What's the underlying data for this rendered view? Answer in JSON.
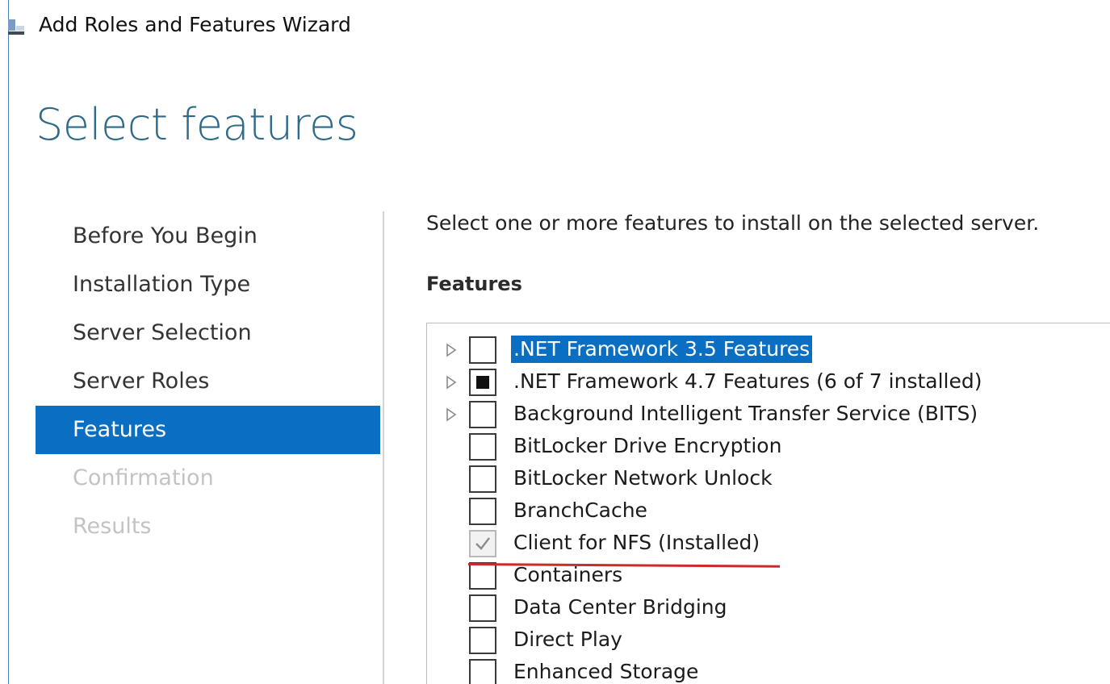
{
  "window": {
    "title": "Add Roles and Features Wizard",
    "icon": "server-manager-icon"
  },
  "page_title": "Select features",
  "nav": {
    "items": [
      {
        "label": "Before You Begin",
        "state": "normal"
      },
      {
        "label": "Installation Type",
        "state": "normal"
      },
      {
        "label": "Server Selection",
        "state": "normal"
      },
      {
        "label": "Server Roles",
        "state": "normal"
      },
      {
        "label": "Features",
        "state": "active"
      },
      {
        "label": "Confirmation",
        "state": "disabled"
      },
      {
        "label": "Results",
        "state": "disabled"
      }
    ]
  },
  "content": {
    "instruction": "Select one or more features to install on the selected server.",
    "features_heading": "Features"
  },
  "features": [
    {
      "label": ".NET Framework 3.5 Features",
      "expandable": true,
      "check": "unchecked",
      "selected": true
    },
    {
      "label": ".NET Framework 4.7 Features (6 of 7 installed)",
      "expandable": true,
      "check": "partial",
      "selected": false
    },
    {
      "label": "Background Intelligent Transfer Service (BITS)",
      "expandable": true,
      "check": "unchecked",
      "selected": false
    },
    {
      "label": "BitLocker Drive Encryption",
      "expandable": false,
      "check": "unchecked",
      "selected": false
    },
    {
      "label": "BitLocker Network Unlock",
      "expandable": false,
      "check": "unchecked",
      "selected": false
    },
    {
      "label": "BranchCache",
      "expandable": false,
      "check": "unchecked",
      "selected": false
    },
    {
      "label": "Client for NFS (Installed)",
      "expandable": false,
      "check": "installed",
      "selected": false,
      "annotated": true
    },
    {
      "label": "Containers",
      "expandable": false,
      "check": "unchecked",
      "selected": false
    },
    {
      "label": "Data Center Bridging",
      "expandable": false,
      "check": "unchecked",
      "selected": false
    },
    {
      "label": "Direct Play",
      "expandable": false,
      "check": "unchecked",
      "selected": false
    },
    {
      "label": "Enhanced Storage",
      "expandable": false,
      "check": "unchecked",
      "selected": false
    }
  ],
  "colors": {
    "accent": "#0a6fc2",
    "title": "#2f6a8a",
    "disabled_text": "#c3c3c3",
    "annotation": "#cc2b2b"
  }
}
